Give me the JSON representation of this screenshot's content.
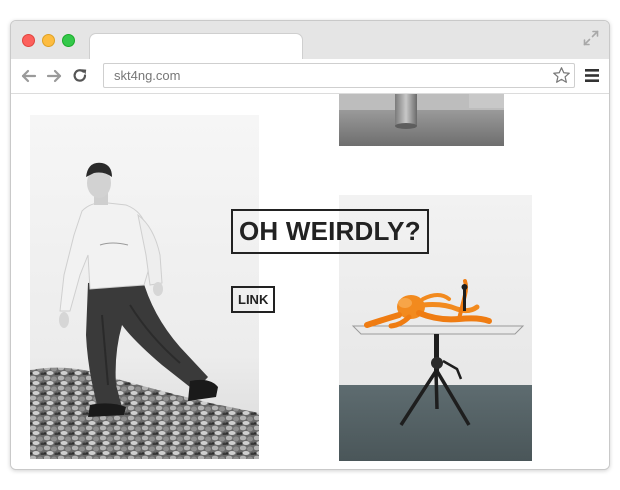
{
  "browser": {
    "url": "skt4ng.com",
    "tab_title": "",
    "traffic_lights": [
      "#fc605c",
      "#fdbc40",
      "#34c84a"
    ]
  },
  "page": {
    "headline": "OH WEIRDLY?",
    "link_label": "LINK",
    "text_color": "#222222"
  },
  "images": {
    "left": "black-and-white photo of a young man in a white sweatshirt and wide dark trousers walking on grey rubble",
    "top_right": "grey gallery photo with a metal cylinder on the floor",
    "bottom_right": "orange octopus sculpture on a white table with a black tripod stand in a gallery"
  },
  "icons": [
    "back-arrow-icon",
    "forward-arrow-icon",
    "reload-icon",
    "star-icon",
    "menu-icon",
    "expand-icon"
  ]
}
